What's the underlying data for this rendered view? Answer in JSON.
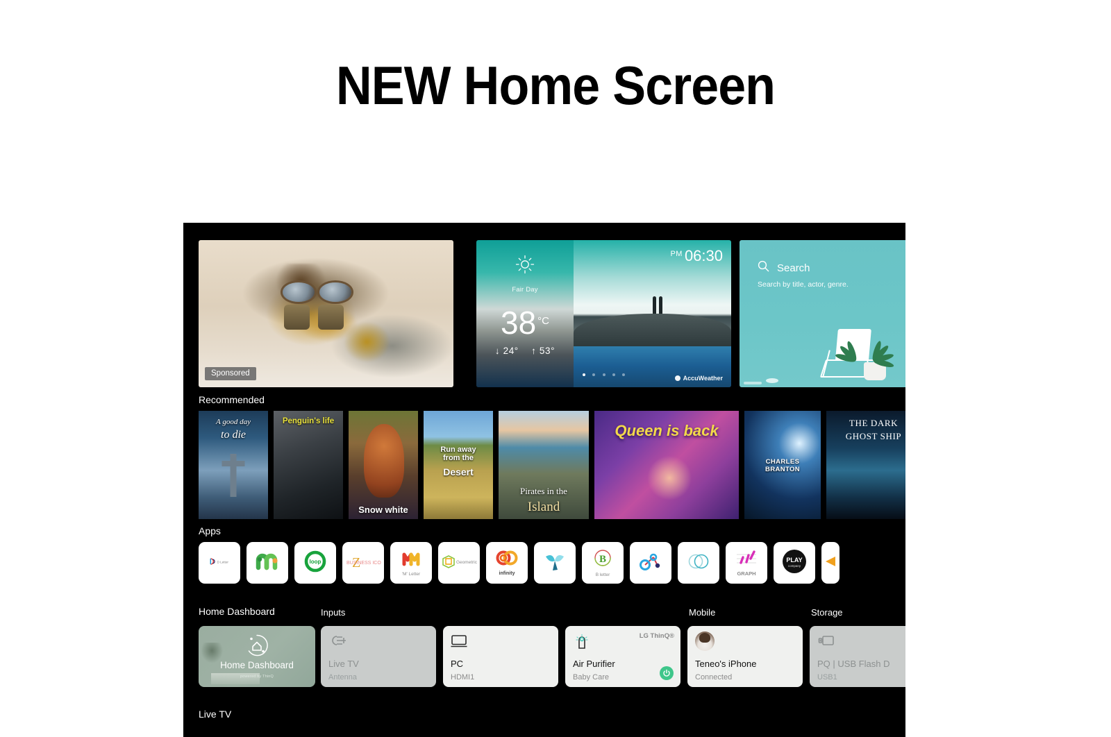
{
  "page": {
    "title": "NEW Home Screen"
  },
  "hero": {
    "sponsored": {
      "badge": "Sponsored",
      "alt": "man-with-binoculars-in-desert"
    },
    "weather": {
      "condition": "Fair Day",
      "temperature": "38",
      "unit": "°C",
      "low": "↓ 24°",
      "high": "↑ 53°",
      "meridiem": "PM",
      "clock": "06:30",
      "provider": "AccuWeather",
      "dots": 5,
      "active_dot": 0
    },
    "search": {
      "label": "Search",
      "subtitle": "Search by title, actor, genre.",
      "icon": "search-icon"
    }
  },
  "recommended": {
    "label": "Recommended",
    "items": [
      {
        "title_top": "A good day",
        "title_main": "to die",
        "style": "serif-italic"
      },
      {
        "title_top": "",
        "title_main": "Penguin's life",
        "style": "yellow-top"
      },
      {
        "title_top": "",
        "title_main": "Snow white",
        "style": "white-bottom"
      },
      {
        "title_top": "Run away\nfrom the",
        "title_main": "Desert",
        "style": "white-mid"
      },
      {
        "title_top": "Pirates in the",
        "title_main": "Island",
        "style": "serif-gold"
      },
      {
        "title_top": "",
        "title_main": "Queen is back",
        "style": "yellow-italic"
      },
      {
        "title_top": "",
        "title_main": "CHARLES BRANTON",
        "style": "white-caps"
      },
      {
        "title_top": "THE DARK",
        "title_main": "GHOST SHIP",
        "style": "serif-caps"
      }
    ]
  },
  "apps": {
    "label": "Apps",
    "items": [
      {
        "name": "D Letter",
        "icon": "d-letter-icon"
      },
      {
        "name": "",
        "icon": "m-worm-icon"
      },
      {
        "name": "loop",
        "icon": "loop-ring-icon"
      },
      {
        "name": "BUSINESS ICON",
        "icon": "z-business-icon"
      },
      {
        "name": "'M' Letter",
        "icon": "m-letter-icon"
      },
      {
        "name": "Geometric",
        "icon": "geometric-cube-icon"
      },
      {
        "name": "infinity",
        "icon": "infinity-rings-icon"
      },
      {
        "name": "",
        "icon": "blue-leaf-icon"
      },
      {
        "name": "B letter",
        "icon": "b-letter-icon"
      },
      {
        "name": "",
        "icon": "molecule-icon"
      },
      {
        "name": "",
        "icon": "two-circles-icon"
      },
      {
        "name": "GRAPH",
        "icon": "graph-icon"
      },
      {
        "name": "",
        "icon": "play-company-icon"
      },
      {
        "name": "",
        "icon": "partial-icon"
      }
    ]
  },
  "dashboard": {
    "groups": [
      {
        "label": "Home Dashboard"
      },
      {
        "label": "Inputs"
      },
      {
        "label": "Mobile"
      },
      {
        "label": "Storage"
      }
    ],
    "cards": [
      {
        "title": "Home Dashboard",
        "sub": "",
        "powered": "powered by ThinQ",
        "state": "focused",
        "icon": "home-dashboard-icon"
      },
      {
        "title": "Live TV",
        "sub": "Antenna",
        "state": "dim",
        "icon": "antenna-icon"
      },
      {
        "title": "PC",
        "sub": "HDMI1",
        "state": "light",
        "icon": "monitor-icon"
      },
      {
        "title": "Air Purifier",
        "sub": "Baby Care",
        "state": "light",
        "badge": "LG ThinQ®",
        "icon": "air-purifier-icon",
        "power": "power-icon"
      },
      {
        "title": "Teneo's iPhone",
        "sub": "Connected",
        "state": "light",
        "icon": "avatar"
      },
      {
        "title": "PQ | USB Flash D",
        "sub": "USB1",
        "state": "dim",
        "icon": "usb-icon"
      }
    ]
  },
  "bottom": {
    "label": "Live TV"
  },
  "colors": {
    "tv_background": "#000000",
    "search_card": "#6cc6c8",
    "weather_teal": "#12a69c",
    "card_light": "#f0f1ef",
    "card_dim": "#c9cccb",
    "home_dashboard": "#9fb2a5",
    "power_green": "#3ec68a"
  }
}
